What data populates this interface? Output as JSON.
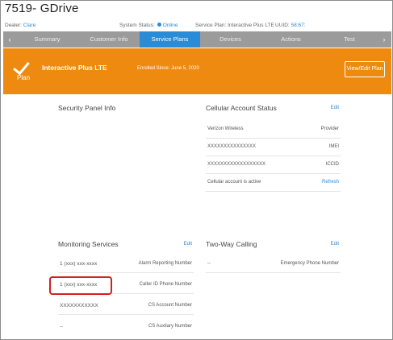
{
  "header": {
    "title": "7519- GDrive"
  },
  "subheader": {
    "dealer_label": "Dealer:",
    "dealer_value": "Clare",
    "system_status_label": "System Status:",
    "system_status_value": "Online",
    "service_plan_label": "Service Plan:",
    "service_plan_value": "Interactive Plus LTE",
    "uuid_label": "UUID:",
    "uuid_value": "58:67:"
  },
  "tabs": {
    "prev_arrow": "‹",
    "items": [
      "Summary",
      "Customer Info",
      "Service Plans",
      "Devices",
      "Actions",
      "Test"
    ],
    "active": "Service Plans",
    "next_arrow": "›"
  },
  "banner": {
    "plan_label": "Plan",
    "plan_name": "Interactive Plus LTE",
    "enrolled": "Enrolled Since: June 5, 2020",
    "edit_button": "View/Edit Plan",
    "color": "#ee8a0f"
  },
  "security_panel": {
    "title": "Security Panel Info"
  },
  "cellular": {
    "title": "Cellular Account Status",
    "edit_label": "Edit",
    "rows": [
      {
        "value": "Verizon Wireless",
        "label": "Provider"
      },
      {
        "value": "XXXXXXXXXXXXXXX",
        "label": "IMEI"
      },
      {
        "value": "XXXXXXXXXXXXXXXXXX",
        "label": "ICCID"
      },
      {
        "value": "Cellular account is active",
        "label": "Refresh"
      }
    ]
  },
  "monitoring": {
    "title": "Monitoring Services",
    "edit_label": "Edit",
    "rows": [
      {
        "value": "1 (xxx) xxx-xxxx",
        "label": "Alarm Reporting Number"
      },
      {
        "value": "1 (xxx) xxx-xxxx",
        "label": "Caller ID Phone Number"
      },
      {
        "value": "XXXXXXXXXXX",
        "label": "CS Account Number"
      },
      {
        "value": "--",
        "label": "CS Auxilary Number"
      }
    ]
  },
  "two_way": {
    "title": "Two-Way Calling",
    "edit_label": "Edit",
    "rows": [
      {
        "value": "--",
        "label": "Emergency Phone Number"
      }
    ]
  },
  "colors": {
    "accent": "#2a8bd6",
    "banner": "#ee8a0f",
    "highlight": "#d41f1f"
  }
}
